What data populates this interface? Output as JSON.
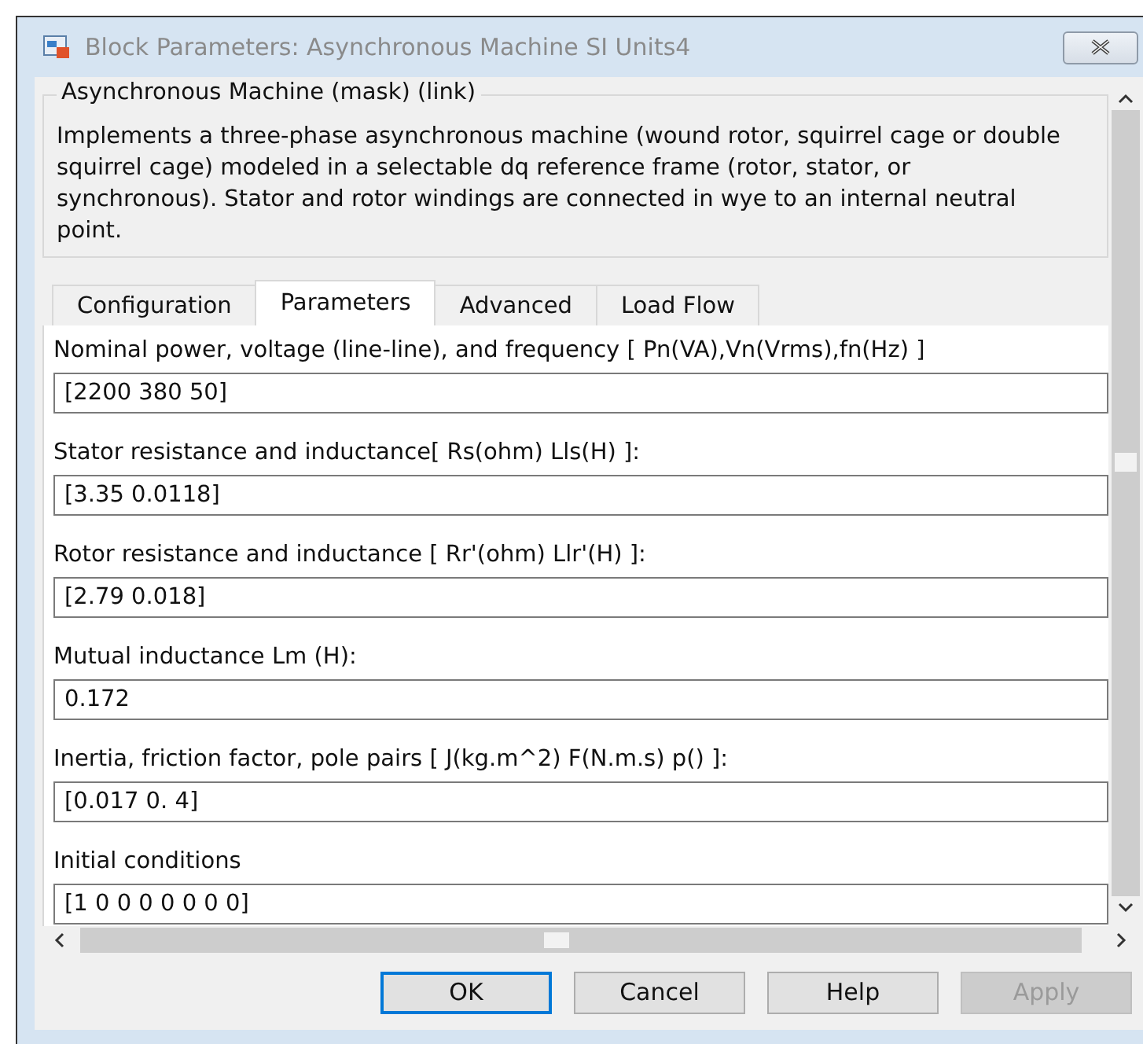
{
  "window": {
    "title": "Block Parameters: Asynchronous Machine SI Units4"
  },
  "group": {
    "title": "Asynchronous Machine (mask) (link)",
    "description": "Implements a three-phase asynchronous machine (wound rotor, squirrel cage or double squirrel cage) modeled in a selectable dq reference frame (rotor, stator, or synchronous). Stator and rotor windings are connected in wye to an internal neutral point."
  },
  "tabs": [
    {
      "label": "Configuration",
      "selected": false
    },
    {
      "label": "Parameters",
      "selected": true
    },
    {
      "label": "Advanced",
      "selected": false
    },
    {
      "label": "Load Flow",
      "selected": false
    }
  ],
  "parameters": [
    {
      "label": "Nominal power, voltage (line-line), and frequency [ Pn(VA),Vn(Vrms),fn(Hz) ]",
      "value": "[2200 380 50]"
    },
    {
      "label": "Stator resistance and inductance[ Rs(ohm)  Lls(H) ]:",
      "value": "[3.35 0.0118]"
    },
    {
      "label": "Rotor resistance and inductance [ Rr'(ohm)  Llr'(H) ]:",
      "value": "[2.79 0.018]"
    },
    {
      "label": "Mutual inductance Lm (H):",
      "value": "0.172"
    },
    {
      "label": "Inertia, friction factor, pole pairs [ J(kg.m^2)  F(N.m.s)   p() ]:",
      "value": "[0.017 0. 4]"
    },
    {
      "label": "Initial conditions",
      "value": "[1 0 0 0 0 0 0 0]"
    }
  ],
  "buttons": [
    {
      "label": "OK",
      "default": true,
      "disabled": false
    },
    {
      "label": "Cancel",
      "default": false,
      "disabled": false
    },
    {
      "label": "Help",
      "default": false,
      "disabled": false
    },
    {
      "label": "Apply",
      "default": false,
      "disabled": true
    }
  ]
}
